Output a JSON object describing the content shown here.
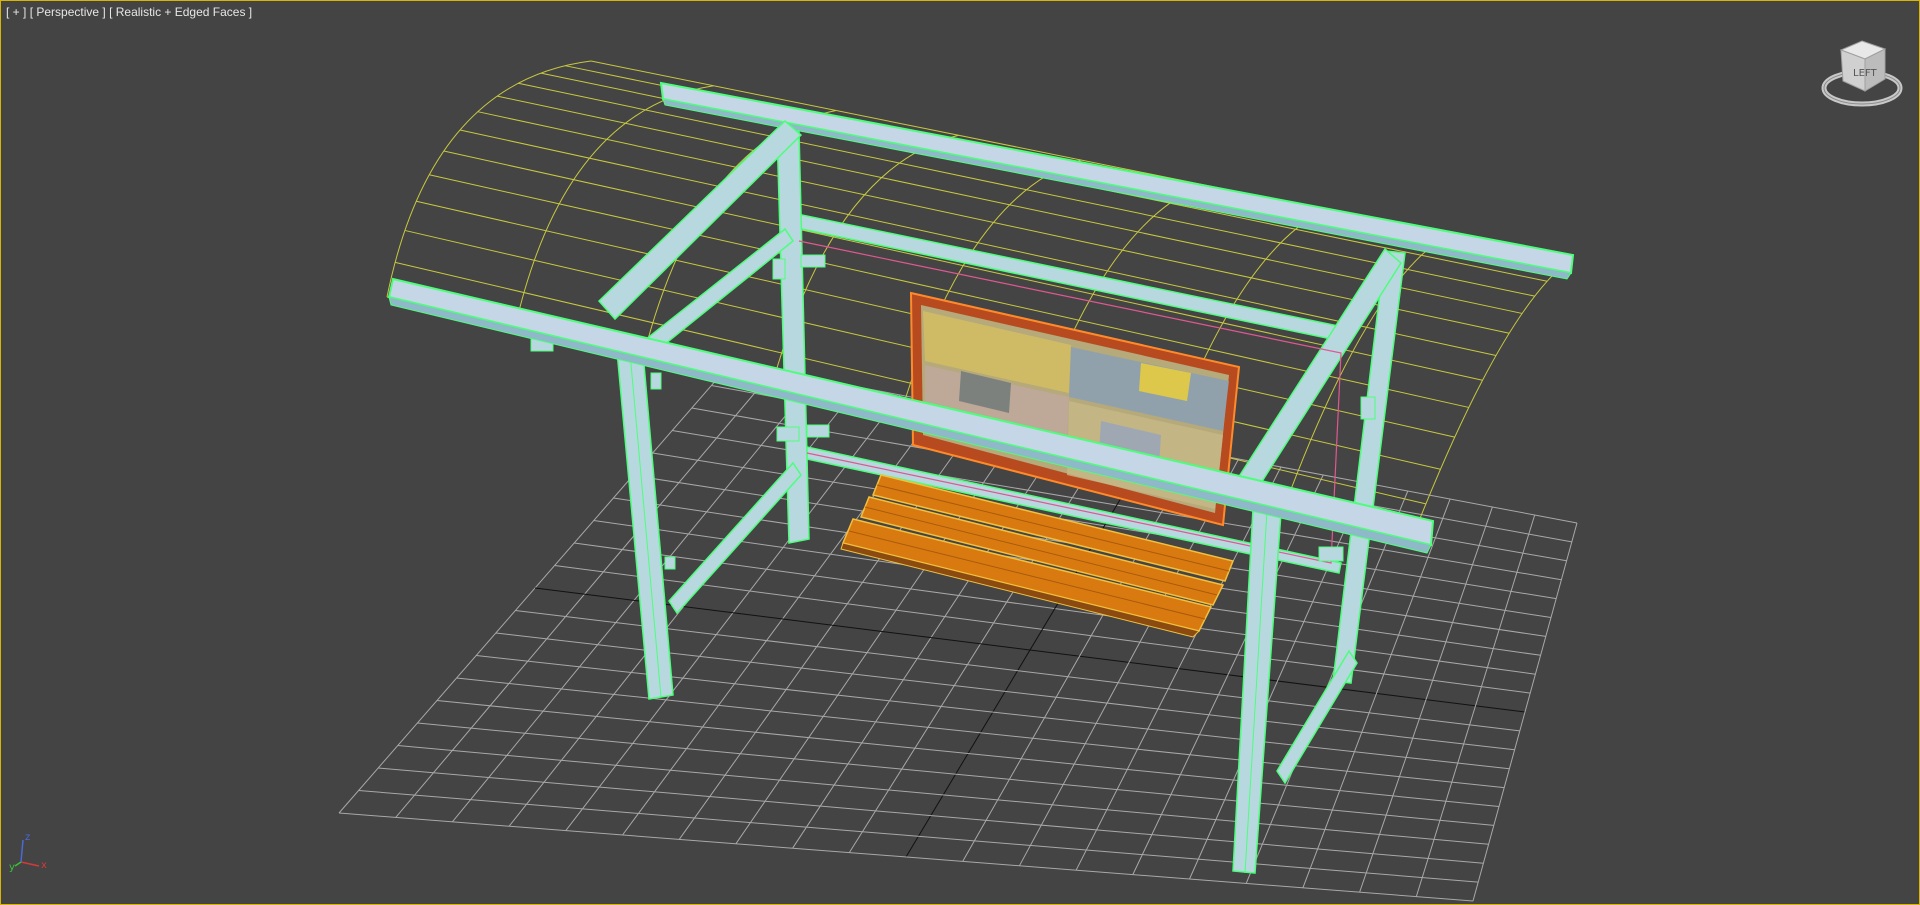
{
  "viewport": {
    "label_open": "[ ",
    "plus_menu": "+",
    "label_mid1": " ] [ ",
    "view_menu": "Perspective",
    "label_mid2": " ] [ ",
    "shading_menu": "Realistic + Edged Faces",
    "label_close": " ]",
    "active_border_color": "#d9b400",
    "background_color": "#444444"
  },
  "viewcube": {
    "face_label": "LEFT"
  },
  "axis_tripod": {
    "x": "x",
    "y": "y",
    "z": "z"
  },
  "scene": {
    "objects": [
      "bus-shelter-roof",
      "bus-shelter-frame",
      "advertising-panel",
      "bench"
    ],
    "colors": {
      "grid": "#a8a8a8",
      "roof_wire": "#c8c840",
      "frame_fill": "#b8d8e0",
      "edge_green": "#4cff7a",
      "bench_wood": "#d97a10",
      "panel_frame": "#c8582a"
    }
  }
}
